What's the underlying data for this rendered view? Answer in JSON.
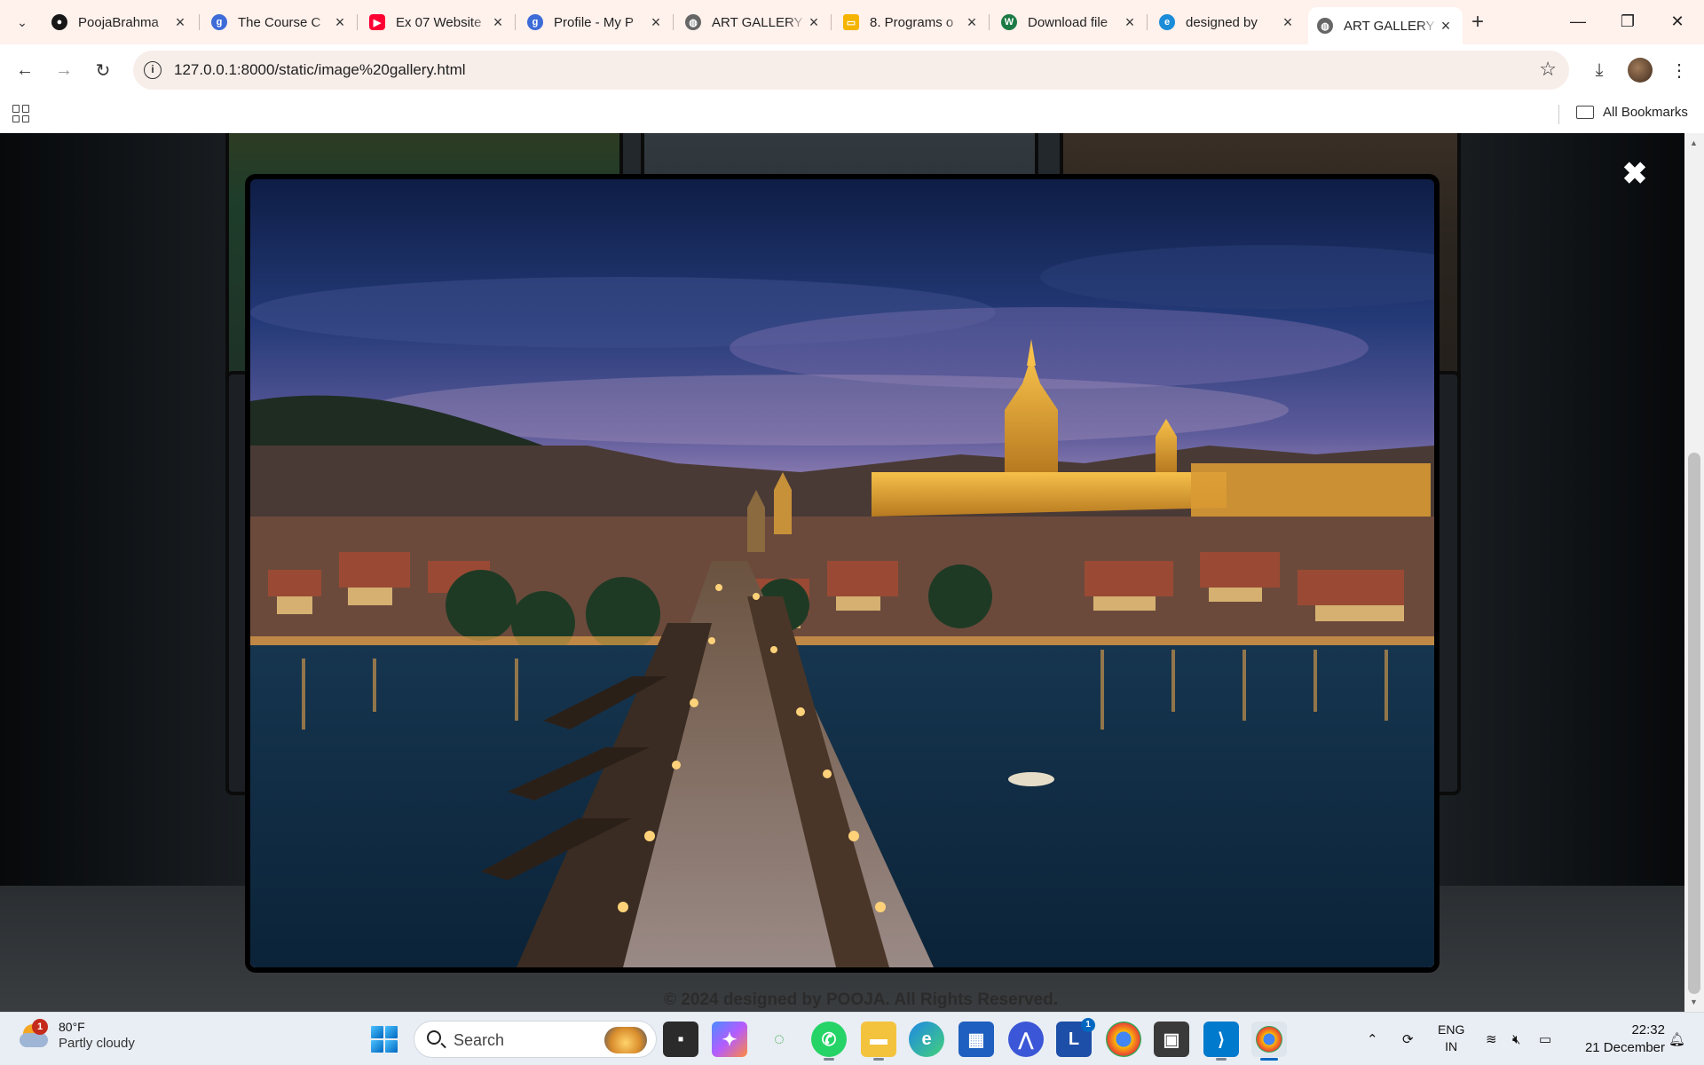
{
  "browser": {
    "tabs": [
      {
        "title": "PoojaBrahma",
        "favicon": "github-icon",
        "color": "#181717"
      },
      {
        "title": "The Course C",
        "favicon": "globe-icon",
        "color": "#3d6bd8"
      },
      {
        "title": "Ex 07 Website",
        "favicon": "youtube-icon",
        "color": "#ff0033"
      },
      {
        "title": "Profile - My P",
        "favicon": "globe-icon",
        "color": "#3d6bd8"
      },
      {
        "title": "ART GALLERY",
        "favicon": "globe-icon",
        "color": "#555555"
      },
      {
        "title": "8. Programs o",
        "favicon": "slides-icon",
        "color": "#f4b400"
      },
      {
        "title": "Download file",
        "favicon": "w-icon",
        "color": "#1b7a45"
      },
      {
        "title": "designed by",
        "favicon": "edge-icon",
        "color": "#1a8cd8"
      },
      {
        "title": "ART GALLERY",
        "favicon": "globe-icon",
        "color": "#555555",
        "active": true
      }
    ],
    "new_tab_label": "+",
    "url": "127.0.0.1:8000/static/image%20gallery.html",
    "bookmarks_label": "All Bookmarks"
  },
  "page": {
    "close_symbol": "✖",
    "footer": "© 2024 designed by POOJA. All Rights Reserved.",
    "modal_image": "prague-charles-bridge-night-photo",
    "background_cards": 6
  },
  "taskbar": {
    "weather": {
      "temp": "80°F",
      "condition": "Partly cloudy",
      "badge": "1"
    },
    "search_label": "Search",
    "apps": [
      "file-explorer-icon",
      "copilot-icon",
      "refresh-app-icon",
      "whatsapp-icon",
      "folder-icon",
      "edge-icon",
      "store-icon",
      "affinity-icon",
      "lens-icon",
      "chrome-icon",
      "terminal-icon",
      "vscode-icon",
      "chrome-active-icon"
    ],
    "lens_badge": "1",
    "lang_top": "ENG",
    "lang_bottom": "IN",
    "time": "22:32",
    "date": "21 December"
  },
  "colors": {
    "tabstrip": "#fff1ec",
    "taskbar": "#e9eef4",
    "accent": "#0067c0"
  }
}
